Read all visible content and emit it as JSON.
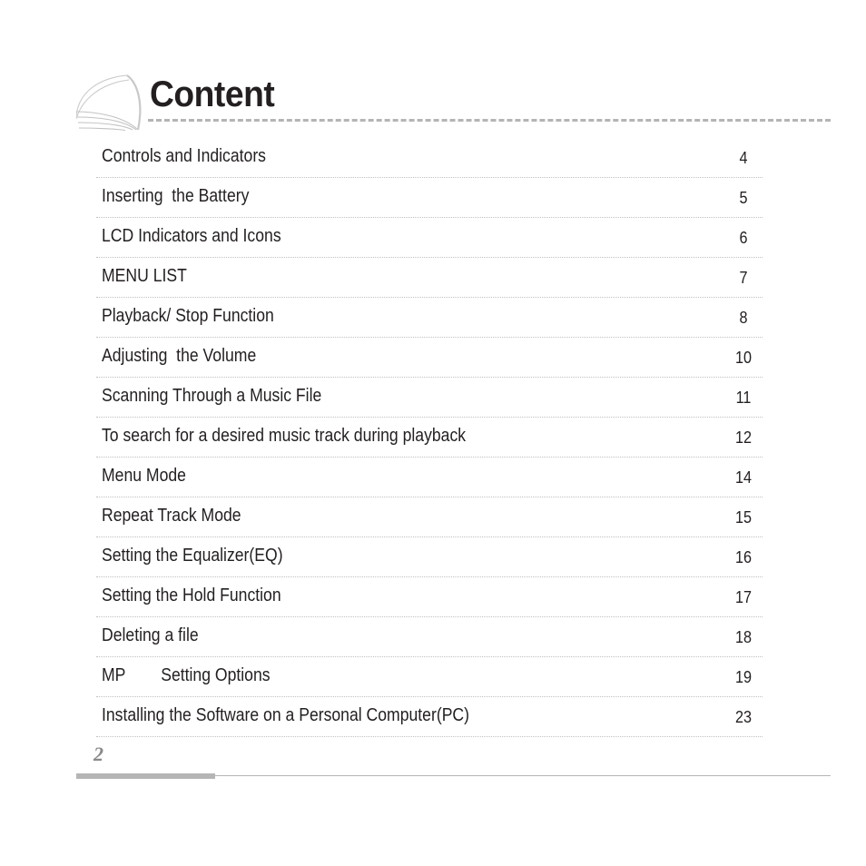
{
  "document": {
    "title": "Content",
    "decoration_icon": "feather-arc-ornament"
  },
  "toc": {
    "entries": [
      {
        "label": "Controls and Indicators",
        "page": "4"
      },
      {
        "label": "Inserting  the Battery",
        "page": "5"
      },
      {
        "label": "LCD Indicators and Icons",
        "page": "6"
      },
      {
        "label": "MENU LIST",
        "page": "7"
      },
      {
        "label": "Playback/ Stop Function",
        "page": "8"
      },
      {
        "label": "Adjusting  the Volume",
        "page": "10"
      },
      {
        "label": "Scanning Through a Music File",
        "page": "11"
      },
      {
        "label": "To search for a desired music track during playback",
        "page": "12"
      },
      {
        "label": "Menu Mode",
        "page": "14"
      },
      {
        "label": "Repeat Track Mode",
        "page": "15"
      },
      {
        "label": "Setting the Equalizer(EQ)",
        "page": "16"
      },
      {
        "label": "Setting the Hold Function",
        "page": "17"
      },
      {
        "label": "Deleting a file",
        "page": "18"
      },
      {
        "label": "MP        Setting Options",
        "page": "19"
      },
      {
        "label": "Installing the Software on a Personal Computer(PC)",
        "page": "23"
      }
    ]
  },
  "footer": {
    "folio": "2"
  },
  "colors": {
    "text": "#231f20",
    "rule": "#b4b4b6",
    "dotted": "#c0c0c0",
    "footer_gray": "#8a8a8a",
    "footer_bar": "#b5b5b5",
    "ornament": "#c9c9cb"
  }
}
